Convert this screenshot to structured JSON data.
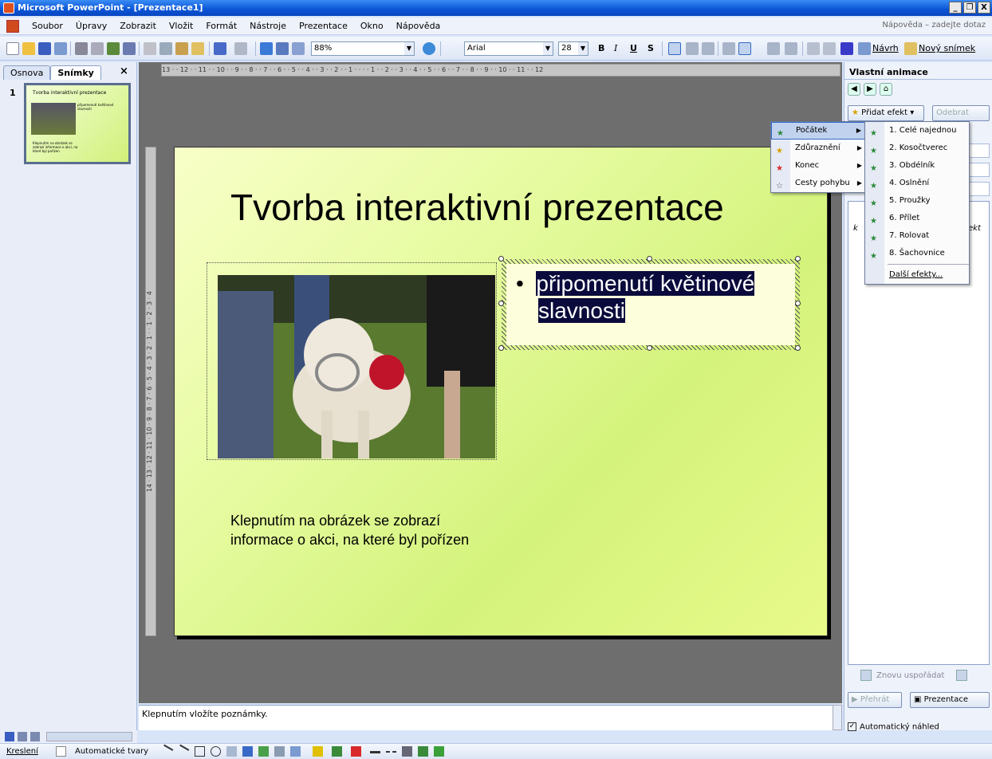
{
  "window": {
    "title": "Microsoft PowerPoint - [Prezentace1]",
    "min": "_",
    "max": "ð",
    "close": "X"
  },
  "menu": {
    "items": [
      "Soubor",
      "Úpravy",
      "Zobrazit",
      "Vložit",
      "Formát",
      "Nástroje",
      "Prezentace",
      "Okno",
      "Nápověda"
    ],
    "help_placeholder": "Nápověda – zadejte dotaz"
  },
  "toolbar": {
    "zoom": "88%",
    "font": "Arial",
    "font_size": "28",
    "bold": "B",
    "italic": "I",
    "underline": "U",
    "shadow": "S",
    "design_label": "Návrh",
    "new_slide_label": "Nový snímek"
  },
  "left_pane": {
    "tabs": [
      "Osnova",
      "Snímky"
    ],
    "active_tab": "Snímky",
    "close": "×",
    "slide_number": "1",
    "thumb_title": "Tvorba interaktivní prezentace",
    "thumb_bullet": "připomenutí květinové slavnosti",
    "thumb_caption": "Klepnutím na obrázek se zobrazí informace o akci, na které byl pořízen"
  },
  "ruler": {
    "horizontal": "13 · · 12 · · 11 · · 10 · · 9 · · 8 · · 7 · · 6 · · 5 · · 4 · · 3 · · 2 · · 1 · · · · 1 · · 2 · · 3 · · 4 · · 5 · · 6 · · 7 · · 8 · · 9 · · 10 · · 11 · · 12",
    "vertical": "14 · 13 · 12 · 11 · 10 · 9 · 8 · 7 · 6 · 5 · 4 · 3 · 2 · 1 · · 1 · 2 · 3 · 4"
  },
  "slide": {
    "title": "Tvorba interaktivní prezentace",
    "bullet_line1": "připomenutí květinové",
    "bullet_line2": "slavnosti",
    "caption": "Klepnutím na obrázek se zobrazí informace o akci, na které byl pořízen"
  },
  "notes": {
    "placeholder": "Klepnutím vložíte poznámky."
  },
  "task_pane": {
    "title": "Vlastní animace",
    "add_effect": "Přidat efekt",
    "remove": "Odebrat",
    "list_fragment_left": "k",
    "list_fragment_right": "ekt",
    "reorder": "Znovu uspořádat",
    "play": "Přehrát",
    "slideshow": "Prezentace",
    "autopreview": "Automatický náhled",
    "autopreview_checked": "✓"
  },
  "effect_menu": {
    "items": [
      "Počátek",
      "Zdůraznění",
      "Konec",
      "Cesty pohybu"
    ],
    "selected": "Počátek"
  },
  "entrance_menu": {
    "items": [
      "1. Celé najednou",
      "2. Kosočtverec",
      "3. Obdélník",
      "4. Oslnění",
      "5. Proužky",
      "6. Přílet",
      "7. Rolovat",
      "8. Šachovnice"
    ],
    "more": "Další efekty..."
  },
  "drawing": {
    "draw_label": "Kreslení",
    "autoshapes_label": "Automatické tvary"
  },
  "colors": {
    "title_bar": "#0a54d6",
    "slide_bg": "#e6fba0",
    "selection": "#0a0a3c",
    "menu_hover": "#c1d2ee"
  }
}
